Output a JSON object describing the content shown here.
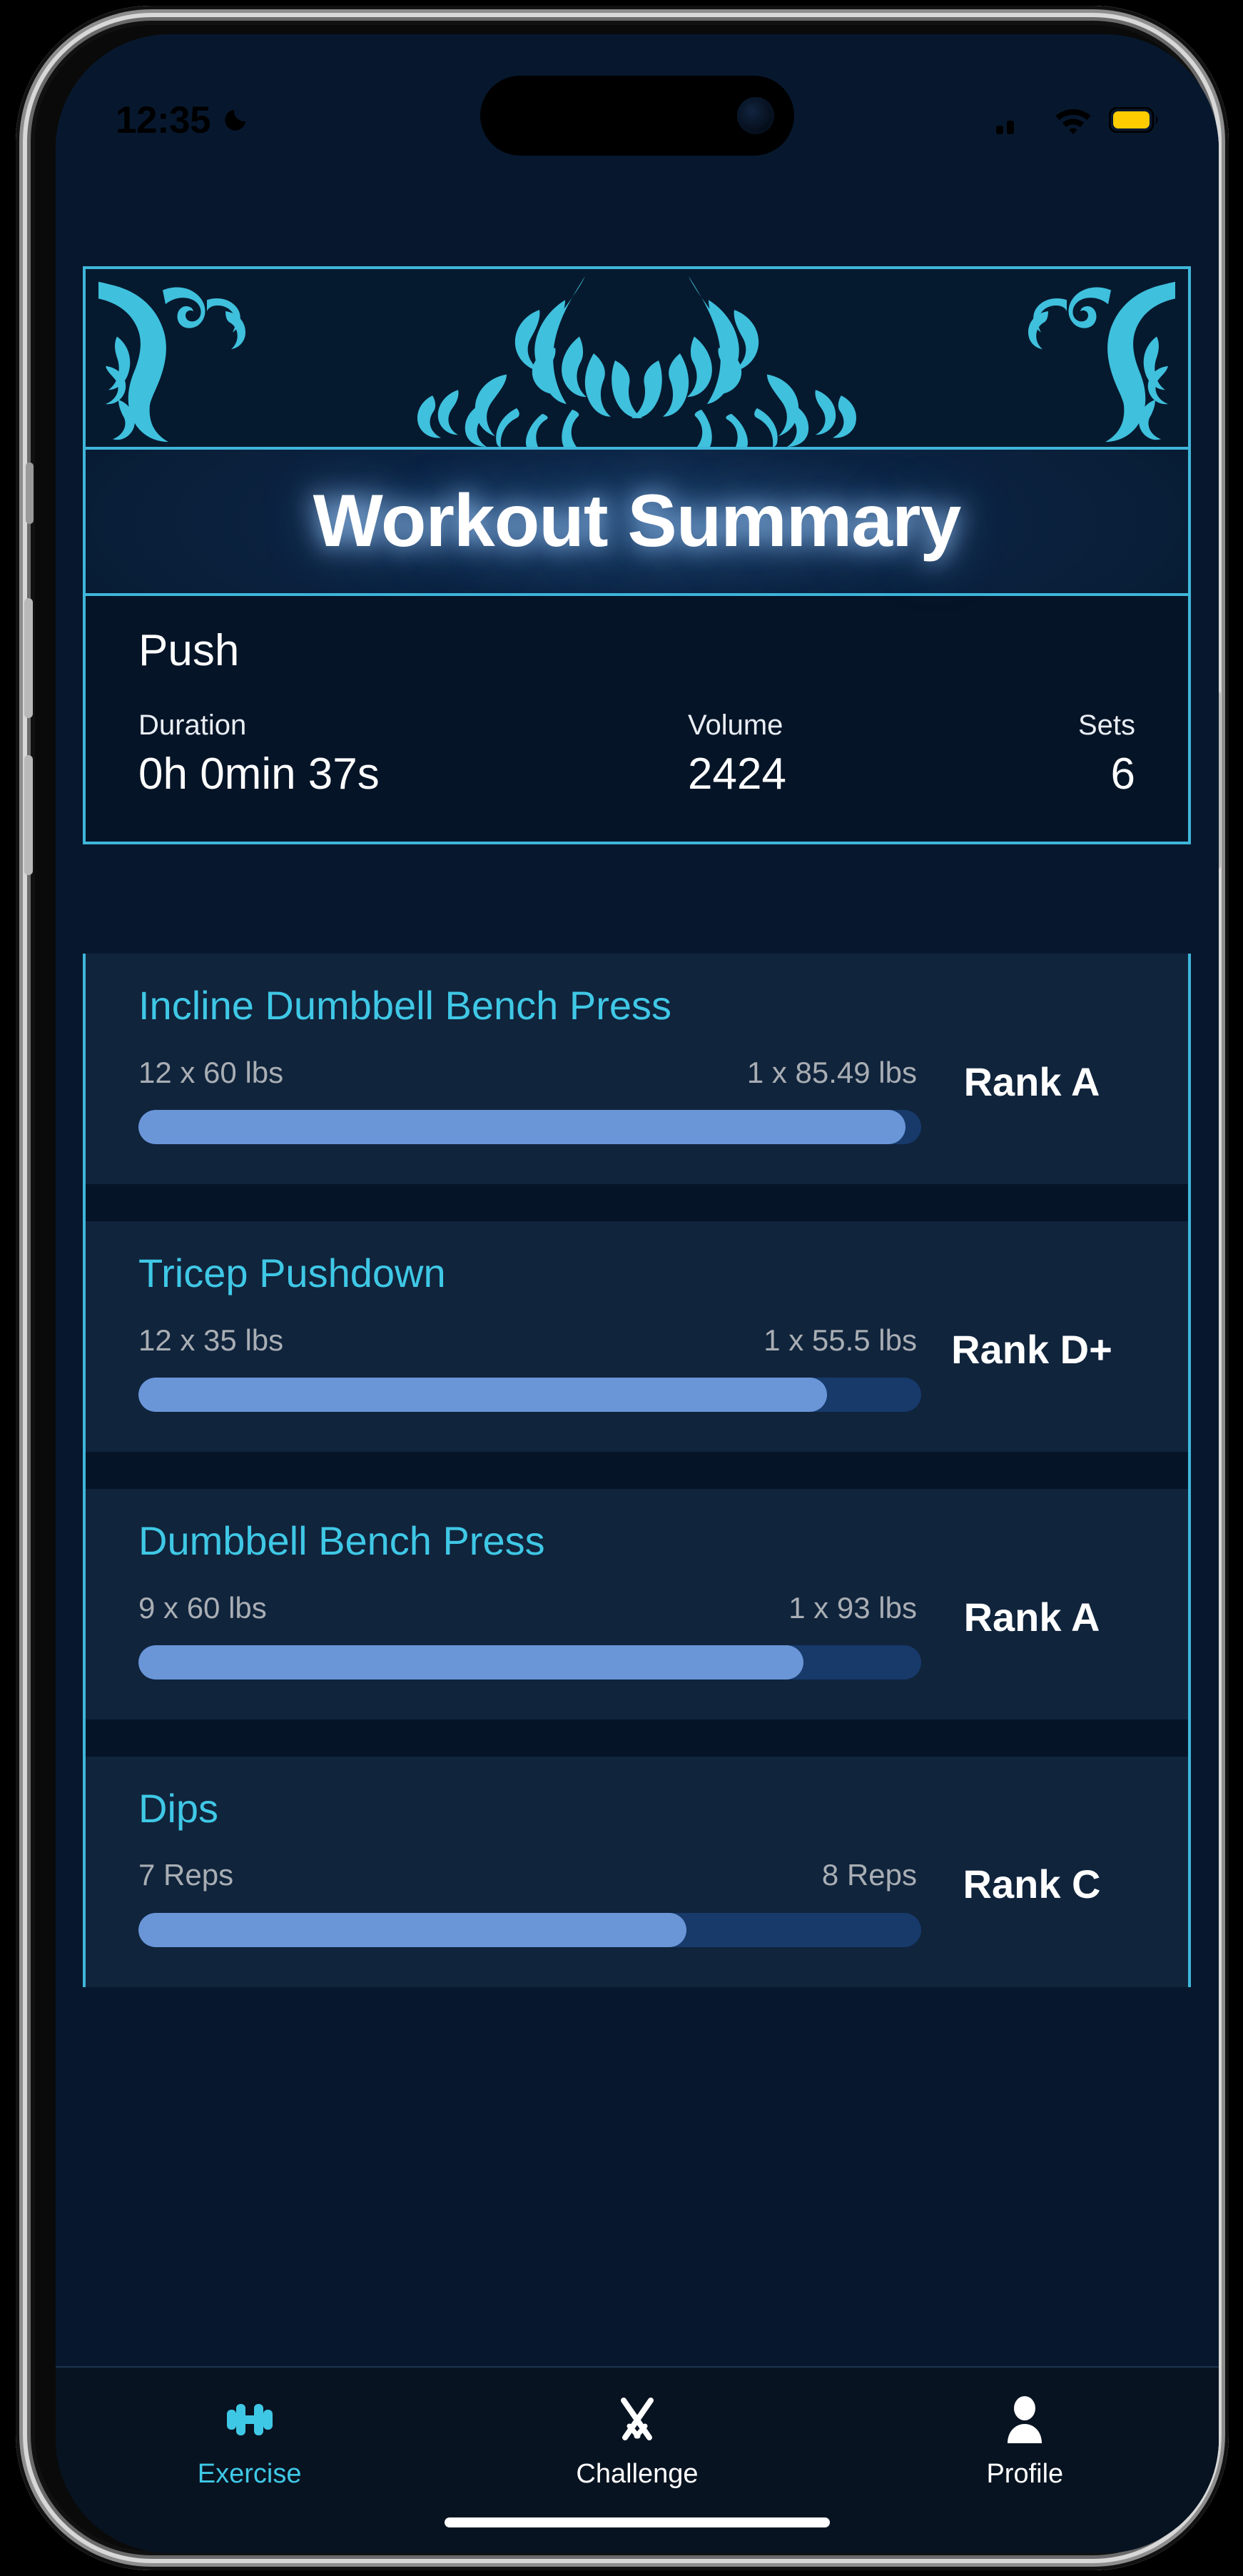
{
  "status_bar": {
    "time": "12:35",
    "dnd_icon": "moon-icon",
    "signal_icon": "signal-bars-icon",
    "wifi_icon": "wifi-icon",
    "battery_icon": "battery-icon",
    "battery_color": "#ffcc00"
  },
  "header": {
    "ornament": "filigree-flourish-ornament",
    "title": "Workout Summary",
    "accent_color": "#3fb6da"
  },
  "summary": {
    "workout_name": "Push",
    "stats": [
      {
        "label": "Duration",
        "value": "0h 0min 37s"
      },
      {
        "label": "Volume",
        "value": "2424"
      },
      {
        "label": "Sets",
        "value": "6"
      }
    ]
  },
  "exercises": [
    {
      "name": "Incline Dumbbell Bench Press",
      "left_set": "12 x 60 lbs",
      "right_set": "1 x 85.49 lbs",
      "rank": "Rank A",
      "progress_pct": 98
    },
    {
      "name": "Tricep Pushdown",
      "left_set": "12 x 35 lbs",
      "right_set": "1 x 55.5 lbs",
      "rank": "Rank D+",
      "progress_pct": 88
    },
    {
      "name": "Dumbbell Bench Press",
      "left_set": "9 x 60 lbs",
      "right_set": "1 x 93 lbs",
      "rank": "Rank A",
      "progress_pct": 85
    },
    {
      "name": "Dips",
      "left_set": "7 Reps",
      "right_set": "8 Reps",
      "rank": "Rank C",
      "progress_pct": 70
    }
  ],
  "colors": {
    "accent_cyan": "#3fb6da",
    "exercise_title": "#3fc8e6",
    "progress_fill": "#6a96d8",
    "progress_track": "#173a6b",
    "card_bg": "#10243c",
    "screen_bg": "#07182e"
  },
  "tab_bar": {
    "items": [
      {
        "label": "Exercise",
        "icon": "dumbbell-icon",
        "active": true
      },
      {
        "label": "Challenge",
        "icon": "crossed-swords-icon",
        "active": false
      },
      {
        "label": "Profile",
        "icon": "person-icon",
        "active": false
      }
    ]
  }
}
